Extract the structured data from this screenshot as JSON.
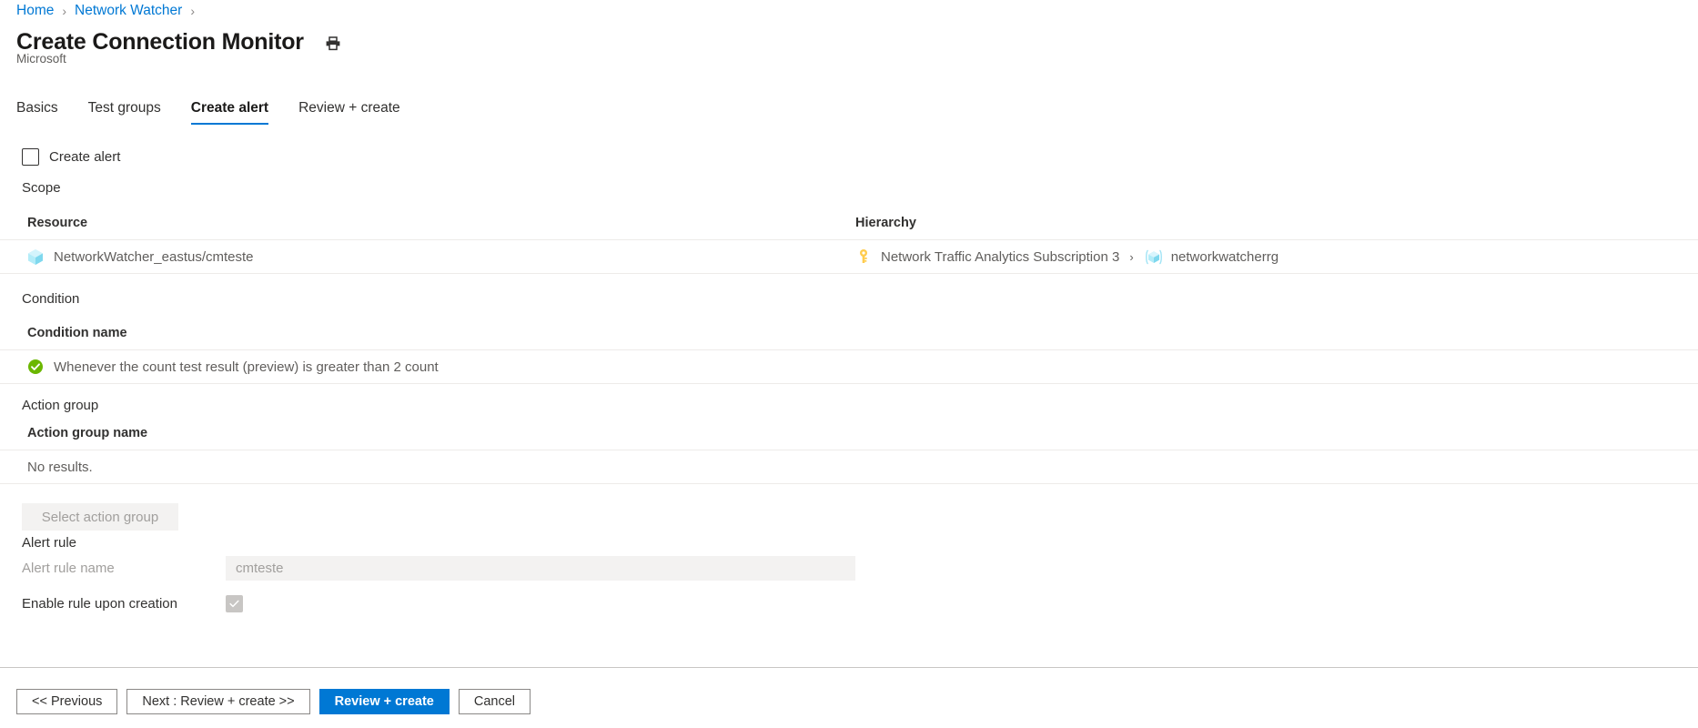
{
  "breadcrumb": {
    "items": [
      {
        "label": "Home"
      },
      {
        "label": "Network Watcher"
      }
    ],
    "separator": "›",
    "trailing_separator": "›"
  },
  "header": {
    "title": "Create Connection Monitor",
    "subtitle": "Microsoft",
    "print_icon": "printer-icon"
  },
  "tabs": [
    {
      "label": "Basics",
      "active": false
    },
    {
      "label": "Test groups",
      "active": false
    },
    {
      "label": "Create alert",
      "active": true
    },
    {
      "label": "Review + create",
      "active": false
    }
  ],
  "create_alert": {
    "checkbox_label": "Create alert",
    "checked": false
  },
  "scope": {
    "section_title": "Scope",
    "columns": [
      "Resource",
      "Hierarchy"
    ],
    "rows": [
      {
        "resource_icon": "cube-icon",
        "resource": "NetworkWatcher_eastus/cmteste",
        "hierarchy_icon": "key-icon",
        "hierarchy_subscription": "Network Traffic Analytics Subscription 3",
        "hierarchy_separator": "›",
        "hierarchy_group_icon": "resource-group-icon",
        "hierarchy_group": "networkwatcherrg"
      }
    ]
  },
  "condition": {
    "section_title": "Condition",
    "column": "Condition name",
    "rows": [
      {
        "status_icon": "success-check-icon",
        "text": "Whenever the count test result (preview) is greater than 2 count"
      }
    ]
  },
  "action_group": {
    "section_title": "Action group",
    "column": "Action group name",
    "empty_text": "No results.",
    "select_button": "Select action group"
  },
  "alert_rule": {
    "section_title": "Alert rule",
    "name_label": "Alert rule name",
    "name_value": "cmteste",
    "enable_label": "Enable rule upon creation",
    "enable_checked": true
  },
  "footer": {
    "buttons": [
      {
        "label": "<< Previous",
        "primary": false
      },
      {
        "label": "Next : Review + create >>",
        "primary": false
      },
      {
        "label": "Review + create",
        "primary": true
      },
      {
        "label": "Cancel",
        "primary": false
      }
    ]
  },
  "colors": {
    "accent": "#0078d4",
    "success": "#6bb700",
    "key": "#ffcc4d",
    "cube": "#9fe3f5",
    "divider": "#edebe9"
  }
}
